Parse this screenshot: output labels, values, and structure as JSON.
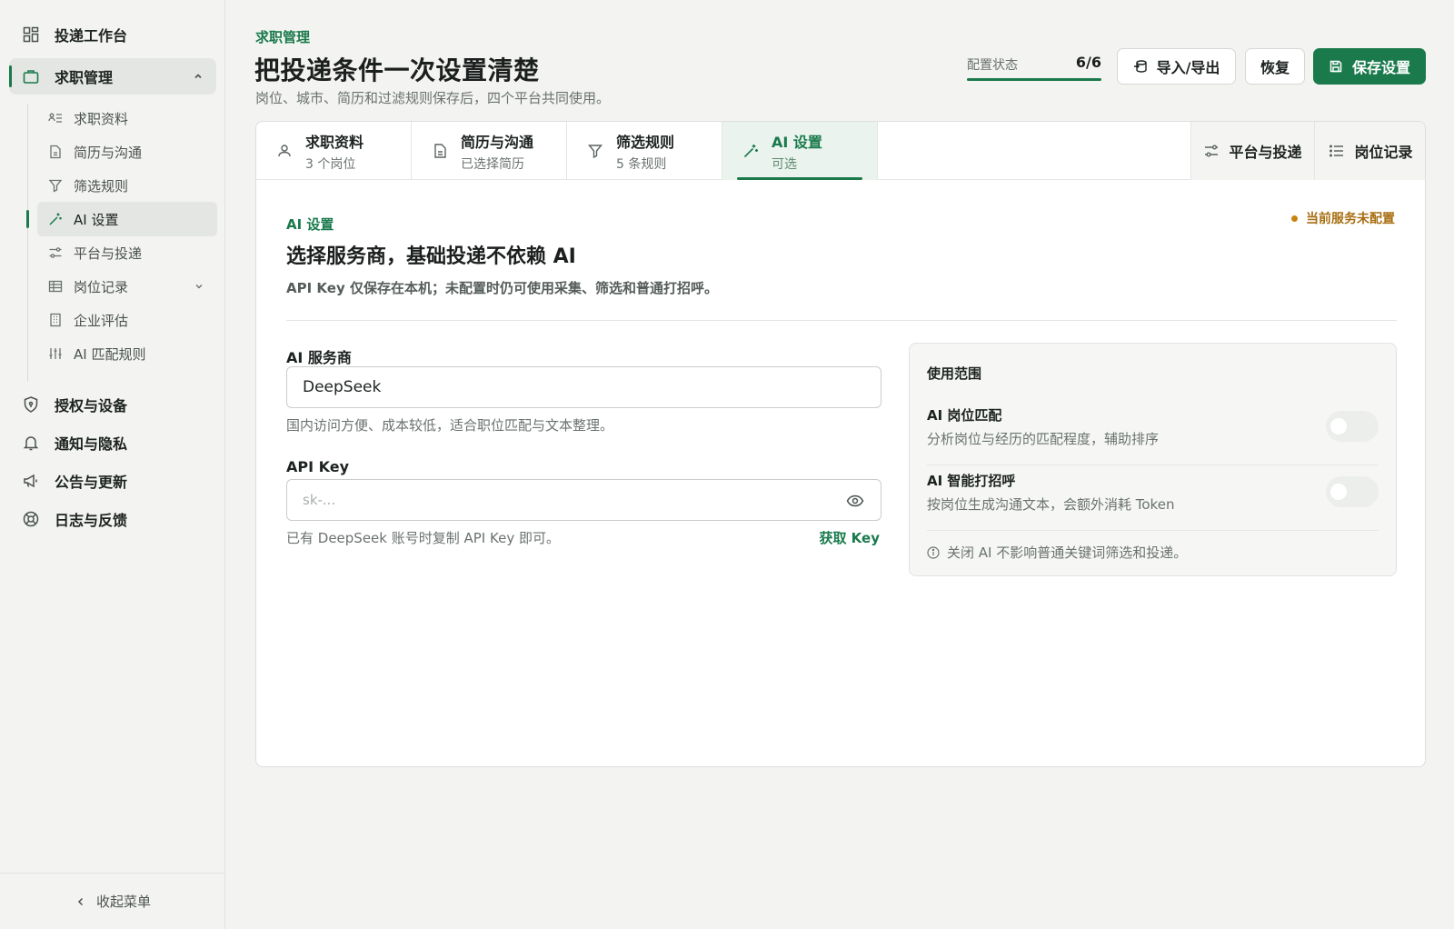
{
  "sidebar": {
    "top_items": [
      {
        "label": "投递工作台",
        "icon": "dashboard-icon"
      },
      {
        "label": "求职管理",
        "icon": "briefcase-icon"
      }
    ],
    "sub_items": [
      {
        "label": "求职资料",
        "icon": "profile-list-icon"
      },
      {
        "label": "简历与沟通",
        "icon": "document-icon"
      },
      {
        "label": "筛选规则",
        "icon": "filter-icon"
      },
      {
        "label": "AI 设置",
        "icon": "magic-wand-icon"
      },
      {
        "label": "平台与投递",
        "icon": "sliders-icon"
      },
      {
        "label": "岗位记录",
        "icon": "table-icon"
      },
      {
        "label": "企业评估",
        "icon": "building-icon"
      },
      {
        "label": "AI 匹配规则",
        "icon": "tune-icon"
      }
    ],
    "bottom_items": [
      {
        "label": "授权与设备",
        "icon": "shield-icon"
      },
      {
        "label": "通知与隐私",
        "icon": "bell-icon"
      },
      {
        "label": "公告与更新",
        "icon": "megaphone-icon"
      },
      {
        "label": "日志与反馈",
        "icon": "lifebuoy-icon"
      }
    ],
    "collapse_label": "收起菜单"
  },
  "header": {
    "eyebrow": "求职管理",
    "title": "把投递条件一次设置清楚",
    "subtitle": "岗位、城市、简历和过滤规则保存后，四个平台共同使用。",
    "config_status_label": "配置状态",
    "config_status_value": "6/6",
    "config_progress": 1.0,
    "import_export_label": "导入/导出",
    "restore_label": "恢复",
    "save_label": "保存设置"
  },
  "tabs": [
    {
      "title": "求职资料",
      "sub": "3 个岗位",
      "icon": "user-icon"
    },
    {
      "title": "简历与沟通",
      "sub": "已选择简历",
      "icon": "document-icon"
    },
    {
      "title": "筛选规则",
      "sub": "5 条规则",
      "icon": "filter-icon"
    },
    {
      "title": "AI 设置",
      "sub": "可选",
      "icon": "magic-wand-icon"
    }
  ],
  "tabs_right": [
    {
      "label": "平台与投递",
      "icon": "sliders-icon"
    },
    {
      "label": "岗位记录",
      "icon": "list-icon"
    }
  ],
  "ai_section": {
    "eyebrow": "AI 设置",
    "title": "选择服务商，基础投递不依赖 AI",
    "desc": "API Key 仅保存在本机；未配置时仍可使用采集、筛选和普通打招呼。",
    "status": "当前服务未配置",
    "provider_label": "AI 服务商",
    "provider_value": "DeepSeek",
    "provider_hint": "国内访问方便、成本较低，适合职位匹配与文本整理。",
    "api_key_label": "API Key",
    "api_key_placeholder": "sk-...",
    "api_key_hint": "已有 DeepSeek 账号时复制 API Key 即可。",
    "get_key_label": "获取 Key"
  },
  "scope": {
    "title": "使用范围",
    "rows": [
      {
        "name": "AI 岗位匹配",
        "desc": "分析岗位与经历的匹配程度，辅助排序",
        "enabled": false
      },
      {
        "name": "AI 智能打招呼",
        "desc": "按岗位生成沟通文本，会额外消耗 Token",
        "enabled": false
      }
    ],
    "note": "关闭 AI 不影响普通关键词筛选和投递。"
  },
  "colors": {
    "accent": "#1a7a4c",
    "warning": "#c7850f"
  }
}
